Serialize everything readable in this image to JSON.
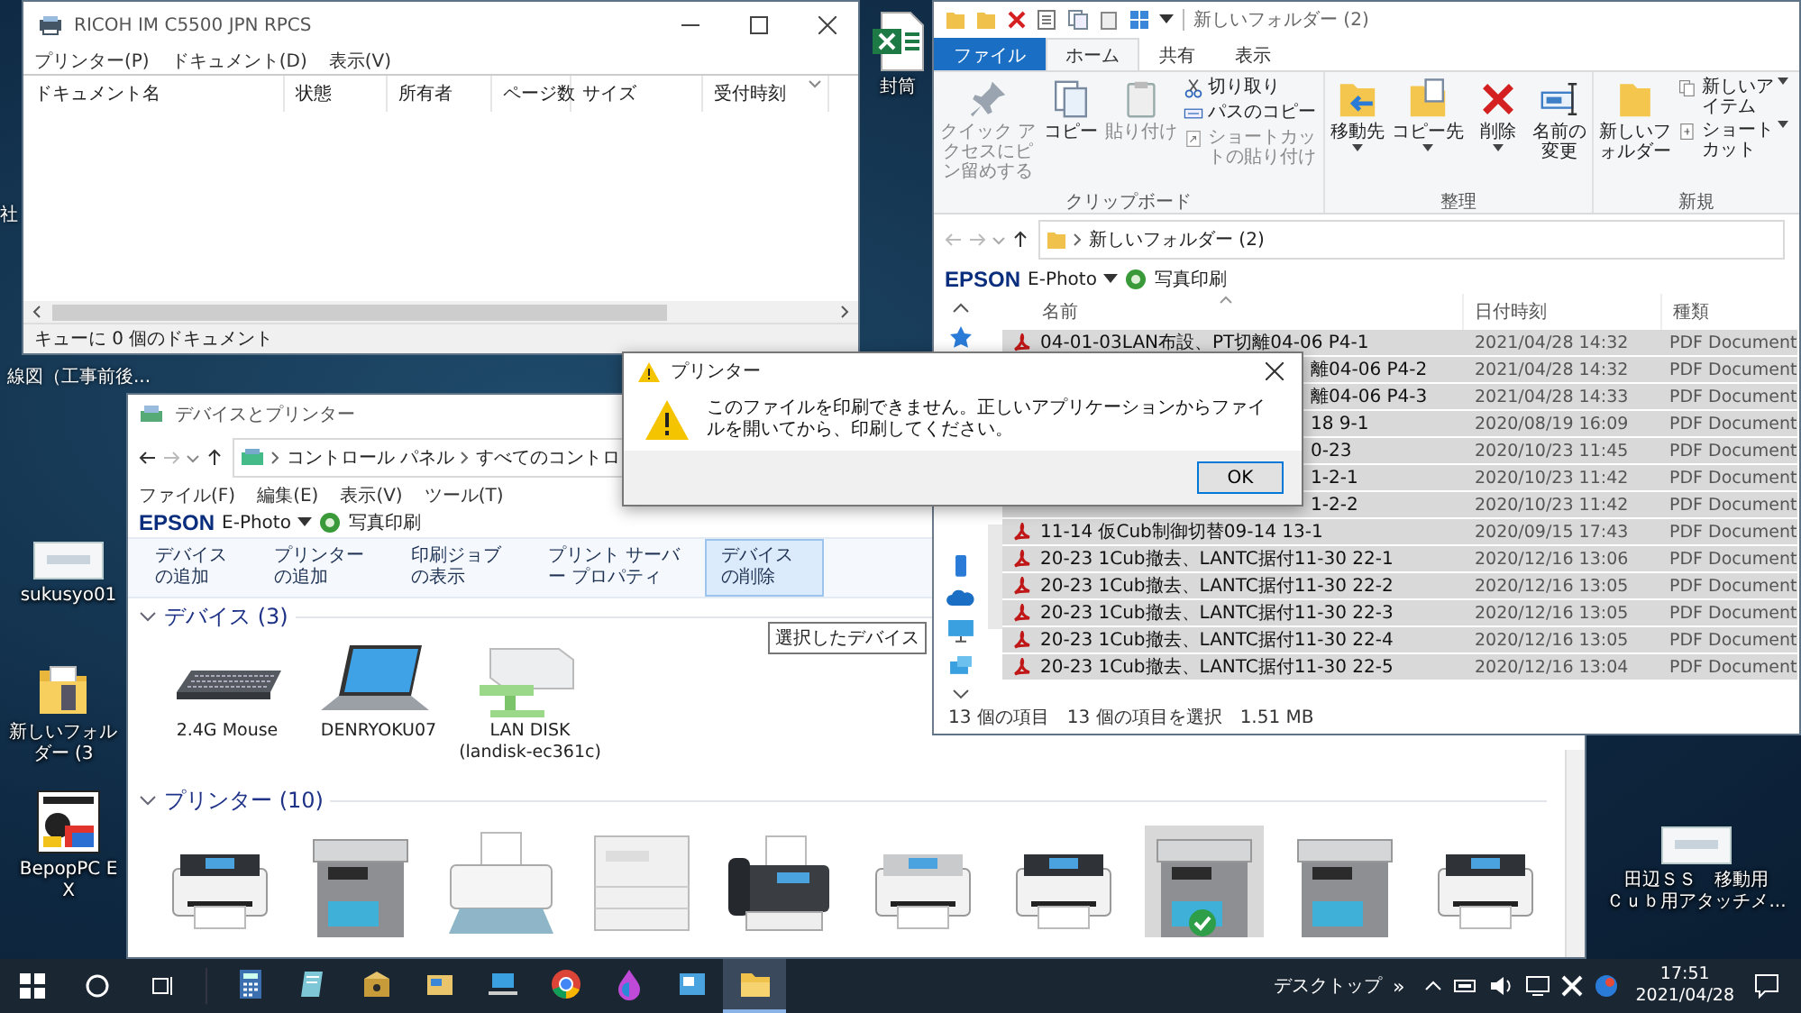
{
  "desktop": {
    "fragments": [
      "社",
      "線図（工事前後..."
    ],
    "icons": [
      {
        "kind": "spreadsheet",
        "lines": [
          "封筒"
        ]
      },
      {
        "kind": "thumbnail",
        "lines": [
          "sukusyo01"
        ]
      },
      {
        "kind": "folder",
        "lines": [
          "新しいフォルダー (3"
        ]
      },
      {
        "kind": "app",
        "lines": [
          "BepopPC EX"
        ]
      },
      {
        "kind": "thumbnail",
        "lines": [
          "田辺ＳＳ　移動用",
          "Ｃｕｂ用アタッチメ..."
        ]
      }
    ]
  },
  "print_queue": {
    "title": "RICOH IM C5500 JPN RPCS",
    "menu": [
      "プリンター(P)",
      "ドキュメント(D)",
      "表示(V)"
    ],
    "columns": [
      "ドキュメント名",
      "状態",
      "所有者",
      "ページ数",
      "サイズ",
      "受付時刻"
    ],
    "status": "キューに 0 個のドキュメント"
  },
  "explorer": {
    "title": "新しいフォルダー (2)",
    "tabs": [
      {
        "label": "ファイル",
        "kind": "file",
        "selected": false
      },
      {
        "label": "ホーム",
        "kind": "tab",
        "selected": true
      },
      {
        "label": "共有",
        "kind": "tab",
        "selected": false
      },
      {
        "label": "表示",
        "kind": "tab",
        "selected": false
      }
    ],
    "ribbon": [
      {
        "label": "クリップボード",
        "large": [
          {
            "kind": "pin",
            "label": "クイック アクセスにピン留めする",
            "disabled": true,
            "menu": false
          },
          {
            "kind": "copy",
            "label": "コピー",
            "disabled": false,
            "menu": false
          },
          {
            "kind": "paste",
            "label": "貼り付け",
            "disabled": true,
            "menu": false
          }
        ],
        "small": [
          {
            "kind": "cut",
            "label": "切り取り",
            "disabled": false,
            "menu": false
          },
          {
            "kind": "path",
            "label": "パスのコピー",
            "disabled": false,
            "menu": false
          },
          {
            "kind": "shortcut",
            "label": "ショートカットの貼り付け",
            "disabled": true,
            "menu": false
          }
        ]
      },
      {
        "label": "整理",
        "large": [
          {
            "kind": "move",
            "label": "移動先",
            "disabled": false,
            "menu": true
          },
          {
            "kind": "copyto",
            "label": "コピー先",
            "disabled": false,
            "menu": true
          },
          {
            "kind": "delete",
            "label": "削除",
            "disabled": false,
            "menu": true
          },
          {
            "kind": "rename",
            "label": "名前の変更",
            "disabled": false,
            "menu": false
          }
        ]
      },
      {
        "label": "新規",
        "large": [
          {
            "kind": "newfolder",
            "label": "新しいフォルダー",
            "disabled": false,
            "menu": false
          }
        ],
        "small": [
          {
            "kind": "newitem",
            "label": "新しいアイテム",
            "disabled": false,
            "menu": true
          },
          {
            "kind": "easyaccess",
            "label": "ショートカット",
            "disabled": false,
            "menu": true
          }
        ]
      }
    ],
    "address": "新しいフォルダー (2)",
    "epson": {
      "brand": "EPSON",
      "product": "E-Photo",
      "action": "写真印刷"
    },
    "columns": [
      "名前",
      "日付時刻",
      "種類"
    ],
    "files": [
      {
        "name": "04-01-03LAN布設、PT切離04-06 P4-1",
        "date": "2021/04/28 14:32",
        "type": "PDF Document",
        "selected": true,
        "covered": false
      },
      {
        "name": "離04-06 P4-2",
        "date": "2021/04/28 14:32",
        "type": "PDF Document",
        "selected": true,
        "covered": true
      },
      {
        "name": "離04-06 P4-3",
        "date": "2021/04/28 14:33",
        "type": "PDF Document",
        "selected": true,
        "covered": true
      },
      {
        "name": "18 9-1",
        "date": "2020/08/19 16:09",
        "type": "PDF Document",
        "selected": true,
        "covered": true
      },
      {
        "name": "0-23",
        "date": "2020/10/23 11:45",
        "type": "PDF Document",
        "selected": true,
        "covered": true
      },
      {
        "name": "1-2-1",
        "date": "2020/10/23 11:42",
        "type": "PDF Document",
        "selected": true,
        "covered": true
      },
      {
        "name": "1-2-2",
        "date": "2020/10/23 11:42",
        "type": "PDF Document",
        "selected": true,
        "covered": true
      },
      {
        "name": "11-14 仮Cub制御切替09-14 13-1",
        "date": "2020/09/15 17:43",
        "type": "PDF Document",
        "selected": true,
        "covered": false
      },
      {
        "name": "20-23 1Cub撤去、LANTC据付11-30 22-1",
        "date": "2020/12/16 13:06",
        "type": "PDF Document",
        "selected": true,
        "covered": false
      },
      {
        "name": "20-23 1Cub撤去、LANTC据付11-30 22-2",
        "date": "2020/12/16 13:05",
        "type": "PDF Document",
        "selected": true,
        "covered": false
      },
      {
        "name": "20-23 1Cub撤去、LANTC据付11-30 22-3",
        "date": "2020/12/16 13:05",
        "type": "PDF Document",
        "selected": true,
        "covered": false
      },
      {
        "name": "20-23 1Cub撤去、LANTC据付11-30 22-4",
        "date": "2020/12/16 13:05",
        "type": "PDF Document",
        "selected": true,
        "covered": false
      },
      {
        "name": "20-23 1Cub撤去、LANTC据付11-30 22-5",
        "date": "2020/12/16 13:04",
        "type": "PDF Document",
        "selected": true,
        "covered": false
      }
    ],
    "status_count": "13 個の項目",
    "status_selected": "13 個の項目を選択",
    "status_size": "1.51 MB"
  },
  "devices": {
    "title": "デバイスとプリンター",
    "address": [
      "コントロール パネル",
      "すべてのコントロ"
    ],
    "menu": [
      "ファイル(F)",
      "編集(E)",
      "表示(V)",
      "ツール(T)"
    ],
    "epson": {
      "brand": "EPSON",
      "product": "E-Photo",
      "action": "写真印刷"
    },
    "commands": [
      {
        "label": "デバイスの追加",
        "highlighted": false
      },
      {
        "label": "プリンターの追加",
        "highlighted": false
      },
      {
        "label": "印刷ジョブの表示",
        "highlighted": false
      },
      {
        "label": "プリント サーバー プロパティ",
        "highlighted": false
      },
      {
        "label": "デバイスの削除",
        "highlighted": true
      }
    ],
    "tooltip": "選択したデバイス",
    "device_header": "デバイス (3)",
    "devices": [
      {
        "kind": "keyboard",
        "label": "2.4G Mouse"
      },
      {
        "kind": "laptop",
        "label": "DENRYOKU07"
      },
      {
        "kind": "nas",
        "label": "LAN DISK",
        "sublabel": "(landisk-ec361c)"
      }
    ],
    "printer_header": "プリンター (10)",
    "printers": [
      {
        "kind": "desktop",
        "selected": false,
        "default": false
      },
      {
        "kind": "mfp",
        "selected": false,
        "default": false
      },
      {
        "kind": "inkjet",
        "selected": false,
        "default": false
      },
      {
        "kind": "office",
        "selected": false,
        "default": false
      },
      {
        "kind": "fax",
        "selected": false,
        "default": false
      },
      {
        "kind": "desktop-light",
        "selected": false,
        "default": false
      },
      {
        "kind": "desktop",
        "selected": false,
        "default": false
      },
      {
        "kind": "mfp",
        "selected": true,
        "default": true
      },
      {
        "kind": "mfp",
        "selected": false,
        "default": false
      },
      {
        "kind": "desktop",
        "selected": false,
        "default": false
      }
    ]
  },
  "dialog": {
    "title": "プリンター",
    "message": "このファイルを印刷できません。正しいアプリケーションからファイルを開いてから、印刷してください。",
    "button": "OK"
  },
  "taskbar": {
    "apps": [
      {
        "kind": "calculator",
        "active": false
      },
      {
        "kind": "notebook",
        "active": false
      },
      {
        "kind": "package",
        "active": false
      },
      {
        "kind": "card",
        "active": false
      },
      {
        "kind": "laptop",
        "active": false
      },
      {
        "kind": "browser",
        "active": false
      },
      {
        "kind": "drop",
        "active": false
      },
      {
        "kind": "picture",
        "active": false
      },
      {
        "kind": "folder",
        "active": true
      }
    ],
    "tray_label": "デスクトップ",
    "overflow": "»",
    "time": "17:51",
    "date": "2021/04/28"
  }
}
